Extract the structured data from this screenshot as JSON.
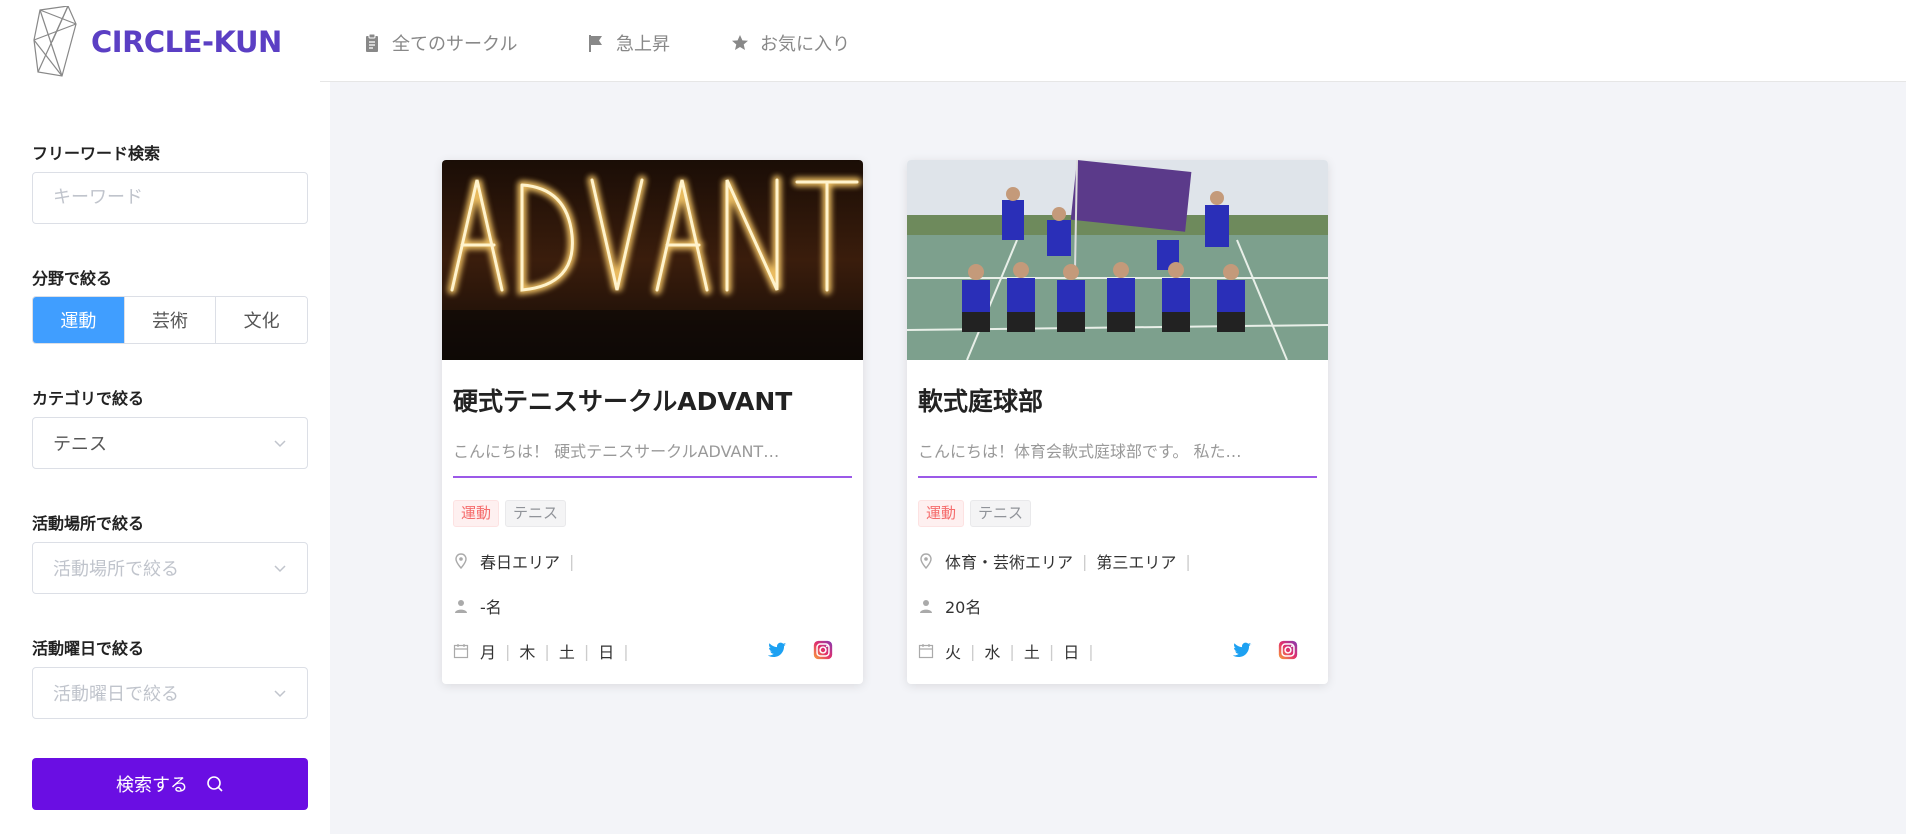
{
  "app": {
    "logo_text": "CIRCLE-KUN"
  },
  "nav": {
    "items": [
      {
        "label": "全てのサークル",
        "icon": "clipboard-icon"
      },
      {
        "label": "急上昇",
        "icon": "flag-icon"
      },
      {
        "label": "お気に入り",
        "icon": "star-icon"
      }
    ]
  },
  "sidebar": {
    "keyword_label": "フリーワード検索",
    "keyword_placeholder": "キーワード",
    "field_label": "分野で絞る",
    "field_options": [
      "運動",
      "芸術",
      "文化"
    ],
    "field_selected": "運動",
    "category_label": "カテゴリで絞る",
    "category_value": "テニス",
    "place_label": "活動場所で絞る",
    "place_placeholder": "活動場所で絞る",
    "day_label": "活動曜日で絞る",
    "day_placeholder": "活動曜日で絞る",
    "search_button": "検索する"
  },
  "cards": [
    {
      "title": "硬式テニスサークルADVANT",
      "description": "こんにちは！ 硬式テニスサークルADVANT…",
      "tags": [
        "運動",
        "テニス"
      ],
      "areas": [
        "春日エリア"
      ],
      "members": "-名",
      "days": [
        "月",
        "木",
        "土",
        "日"
      ]
    },
    {
      "title": "軟式庭球部",
      "description": "こんにちは！体育会軟式庭球部です。 私た…",
      "tags": [
        "運動",
        "テニス"
      ],
      "areas": [
        "体育・芸術エリア",
        "第三エリア"
      ],
      "members": "20名",
      "days": [
        "火",
        "水",
        "土",
        "日"
      ]
    }
  ],
  "colors": {
    "brand": "#5b3fc4",
    "primary": "#409eff",
    "search_button": "#6a0ee3",
    "divider": "#9b59e8",
    "twitter": "#1da1f2"
  }
}
